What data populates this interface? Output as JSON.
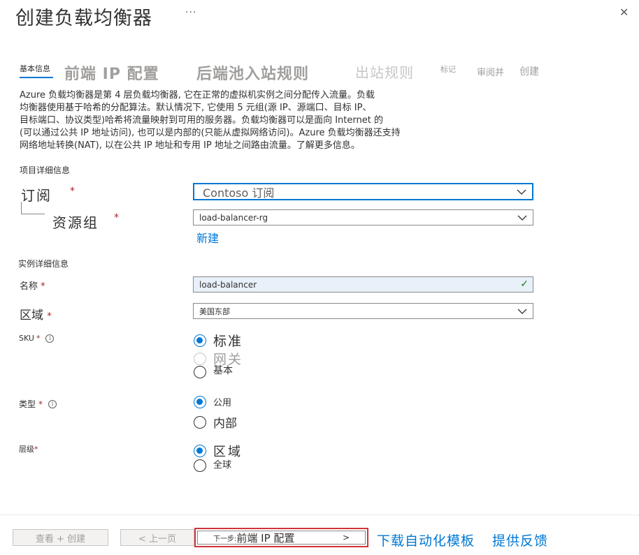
{
  "header": {
    "title": "创建负载均衡器",
    "more": "···",
    "close": "✕"
  },
  "tabs": [
    {
      "label": "基本信息",
      "active": true
    },
    {
      "label": "前端 IP 配置"
    },
    {
      "label": "后端池入站规则"
    },
    {
      "label": "出站规则"
    },
    {
      "label": "标记"
    },
    {
      "label": "审阅并"
    },
    {
      "label": "创建"
    }
  ],
  "description": [
    "Azure 负载均衡器是第 4 层负载均衡器, 它在正常的虚拟机实例之间分配传入流量。负载",
    "均衡器使用基于哈希的分配算法。默认情况下, 它使用 5 元组(源 IP、源端口、目标 IP、",
    "目标端口、协议类型)哈希将流量映射到可用的服务器。负载均衡器可以是面向 Internet 的",
    "(可以通过公共 IP 地址访问), 也可以是内部的(只能从虚拟网络访问)。Azure 负载均衡器还支持",
    "网络地址转换(NAT), 以在公共 IP 地址和专用 IP 地址之间路由流量。了解更多信息。"
  ],
  "project": {
    "heading": "项目详细信息",
    "subscription_label": "订阅",
    "subscription_value": "Contoso 订阅",
    "resource_group_label": "资源组",
    "resource_group_value": "load-balancer-rg",
    "create_new": "新建"
  },
  "instance": {
    "heading": "实例详细信息",
    "name_label": "名称",
    "name_value": "load-balancer",
    "region_label": "区域",
    "region_value": "美国东部",
    "sku_label": "SKU",
    "sku_options": [
      "标准",
      "网关",
      "基本"
    ],
    "sku_selected": "标准",
    "type_label": "类型",
    "type_options": [
      "公用",
      "内部"
    ],
    "type_selected": "公用",
    "tier_label": "层级",
    "tier_options": [
      "区域",
      "全球"
    ],
    "tier_selected": "区域"
  },
  "required_mark": "*",
  "info_icon": "i",
  "footer": {
    "review_create": "查看 + 创建",
    "previous": "< 上一页",
    "next_prefix": "下一步:",
    "next_label": "前端 IP 配置",
    "next_arrow": ">",
    "download_template": "下载自动化模板",
    "feedback": "提供反馈"
  },
  "colors": {
    "accent": "#0078d4",
    "required": "#a4262c",
    "highlight_border": "#d13438",
    "valid_check": "#107c10"
  }
}
